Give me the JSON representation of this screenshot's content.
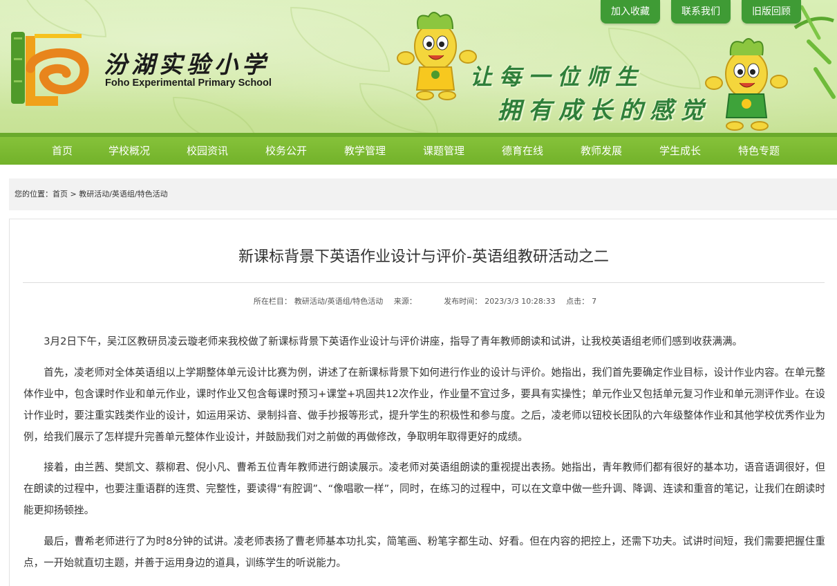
{
  "header": {
    "school_name_cn": "汾湖实验小学",
    "school_name_en": "Foho Experimental Primary School",
    "slogan_line1": "让每一位师生",
    "slogan_line2": "拥有成长的感觉",
    "top_buttons": [
      "加入收藏",
      "联系我们",
      "旧版回顾"
    ],
    "colors": {
      "banner": "#cfe8a2",
      "button": "#3f9b35",
      "nav": "#7ab932",
      "slogan": "#2f7f3a"
    }
  },
  "nav": {
    "items": [
      "首页",
      "学校概况",
      "校园资讯",
      "校务公开",
      "教学管理",
      "课题管理",
      "德育在线",
      "教师发展",
      "学生成长",
      "特色专题"
    ]
  },
  "breadcrumb": {
    "prefix": "您的位置：",
    "home": "首页",
    "sep": " > ",
    "current": "教研活动/英语组/特色活动"
  },
  "article": {
    "title": "新课标背景下英语作业设计与评价-英语组教研活动之二",
    "meta": {
      "column_label": "所在栏目：",
      "column": "教研活动/英语组/特色活动",
      "source_label": "来源：",
      "source": "",
      "time_label": "发布时间：",
      "time": "2023/3/3 10:28:33",
      "hits_label": "点击：",
      "hits": "7"
    },
    "paragraphs": [
      "3月2日下午，吴江区教研员凌云璇老师来我校做了新课标背景下英语作业设计与评价讲座，指导了青年教师朗读和试讲，让我校英语组老师们感到收获满满。",
      "首先，凌老师对全体英语组以上学期整体单元设计比赛为例，讲述了在新课标背景下如何进行作业的设计与评价。她指出，我们首先要确定作业目标，设计作业内容。在单元整体作业中，包含课时作业和单元作业，课时作业又包含每课时预习+课堂+巩固共12次作业，作业量不宜过多，要具有实操性；单元作业又包括单元复习作业和单元测评作业。在设计作业时，要注重实践类作业的设计，如运用采访、录制抖音、做手抄报等形式，提升学生的积极性和参与度。之后，凌老师以钮校长团队的六年级整体作业和其他学校优秀作业为例，给我们展示了怎样提升完善单元整体作业设计，并鼓励我们对之前做的再做修改，争取明年取得更好的成绩。",
      "接着，由兰茜、樊凯文、蔡柳君、倪小凡、曹希五位青年教师进行朗读展示。凌老师对英语组朗读的重视提出表扬。她指出，青年教师们都有很好的基本功，语音语调很好，但在朗读的过程中，也要注重语群的连贯、完整性，要读得“有腔调”、“像唱歌一样”，同时，在练习的过程中，可以在文章中做一些升调、降调、连读和重音的笔记，让我们在朗读时能更抑扬顿挫。",
      "最后，曹希老师进行了为时8分钟的试讲。凌老师表扬了曹老师基本功扎实，简笔画、粉笔字都生动、好看。但在内容的把控上，还需下功夫。试讲时间短，我们需要把握住重点，一开始就直切主题，并善于运用身边的道具，训练学生的听说能力。"
    ]
  }
}
